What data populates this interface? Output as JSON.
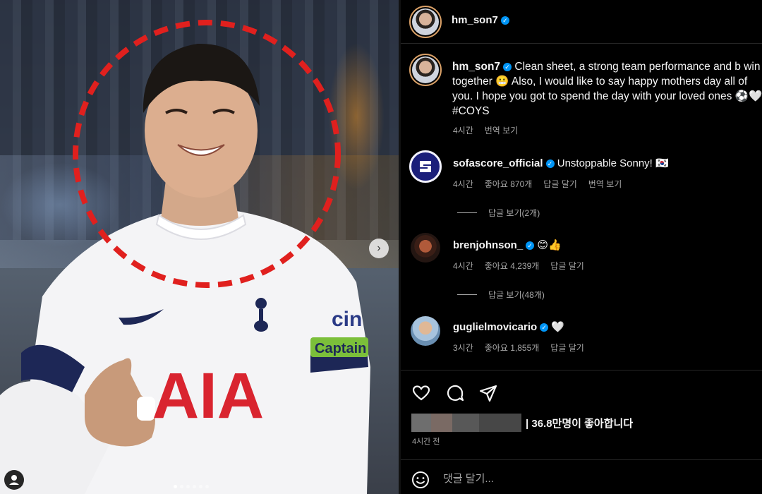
{
  "post": {
    "author": "hm_son7",
    "caption_author": "hm_son7",
    "caption_text": "Clean sheet, a strong team performance and b win together 😬 Also, I would like to say happy mothers day all of you. I hope you got to spend the day with your loved ones ⚽🤍 #COYS",
    "caption_time": "4시간",
    "caption_translate": "번역 보기",
    "likes_text": "| 36.8만명이 좋아합니다",
    "time_ago": "4시간 전"
  },
  "comments": [
    {
      "user": "sofascore_official",
      "text": "Unstoppable Sonny! 🇰🇷",
      "time": "4시간",
      "likes": "좋아요 870개",
      "reply": "답글 달기",
      "translate": "번역 보기",
      "replies_toggle": "답글 보기(2개)"
    },
    {
      "user": "brenjohnson_",
      "text": "😊👍",
      "time": "4시간",
      "likes": "좋아요 4,239개",
      "reply": "답글 달기",
      "replies_toggle": "답글 보기(48개)"
    },
    {
      "user": "guglielmovicario",
      "text": "🤍",
      "time": "3시간",
      "likes": "좋아요 1,855개",
      "reply": "답글 달기"
    }
  ],
  "composer": {
    "placeholder": "댓글 달기..."
  },
  "photo": {
    "shirt_sponsor": "AIA",
    "sleeve_sponsor": "cin",
    "armband": "Captain"
  },
  "icons": {
    "heart": "heart-icon",
    "comment": "comment-icon",
    "share": "share-icon",
    "emoji": "smiley-icon",
    "next": "chevron-right-icon",
    "user": "user-icon",
    "verified": "verified-badge-icon"
  },
  "colors": {
    "background": "#000000",
    "text": "#f5f5f5",
    "muted": "#a8a8a8",
    "verified": "#0095f6",
    "annotation": "#e0201e"
  }
}
